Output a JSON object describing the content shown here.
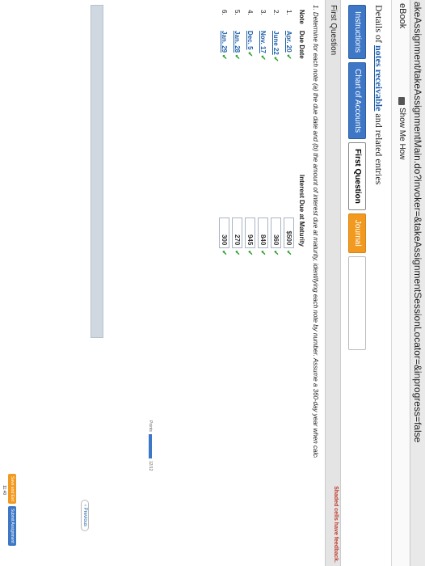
{
  "browser": {
    "url": "akeAssignment/takeAssignmentMain.do?invoker=&takeAssignmentSessionLocator=&inprogress=false"
  },
  "toolbar": {
    "ebook_label": "eBook",
    "show_me_how_label": "Show Me How"
  },
  "page": {
    "title_prefix": "Details of ",
    "title_link": "notes receivable",
    "title_suffix": " and related entries"
  },
  "tabs": [
    {
      "label": "Instructions"
    },
    {
      "label": "Chart of Accounts"
    },
    {
      "label": "First Question"
    },
    {
      "label": "Journal"
    },
    {
      "label": ""
    }
  ],
  "section": {
    "label": "First Question",
    "hint": "Shaded cells have feedback."
  },
  "question": {
    "text": "1. Determine for each note (a) the due date and (b) the amount of interest due at maturity, identifying each note by number. Assume a 360-day year when calculating interest."
  },
  "table": {
    "headers": [
      "Note",
      "Due Date",
      "Interest Due at Maturity"
    ],
    "rows": [
      {
        "note": "1.",
        "due_date": "Apr. 20",
        "interest": "$500"
      },
      {
        "note": "2.",
        "due_date": "June 22",
        "interest": "360"
      },
      {
        "note": "3.",
        "due_date": "Nov. 17",
        "interest": "840"
      },
      {
        "note": "4.",
        "due_date": "Dec. 5",
        "interest": "945"
      },
      {
        "note": "5.",
        "due_date": "Jan. 28",
        "interest": "270"
      },
      {
        "note": "6.",
        "due_date": "Jan. 29",
        "interest": "300"
      }
    ],
    "check_mark": "✔"
  },
  "progress": {
    "label": "Points",
    "count": "12/12",
    "fraction": 1.0
  },
  "nav": {
    "previous_label": "Previous"
  },
  "footer": {
    "save_label": "Save and Exit",
    "submit_label": "Submit Assignment"
  },
  "os": {
    "tray_text": "11:40"
  },
  "colors": {
    "accent_blue": "#3d77c6",
    "accent_orange": "#f29a1f",
    "check_green": "#2ca02c",
    "link_blue": "#1f5fa8"
  }
}
